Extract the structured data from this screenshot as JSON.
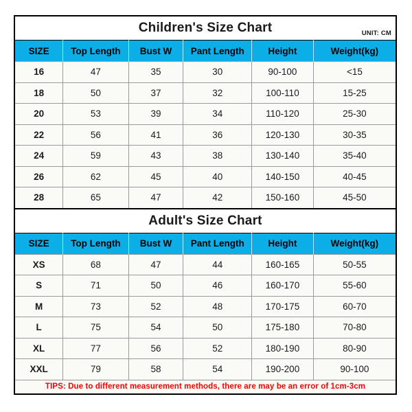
{
  "unit_label": "UNIT: CM",
  "columns": [
    "SIZE",
    "Top Length",
    "Bust W",
    "Pant Length",
    "Height",
    "Weight(kg)"
  ],
  "children": {
    "title": "Children's Size Chart",
    "headers": [
      "SIZE",
      "Top Length",
      "Bust W",
      "Pant Length",
      "Height",
      "Weight(kg)"
    ],
    "rows": [
      [
        "16",
        "47",
        "35",
        "30",
        "90-100",
        "<15"
      ],
      [
        "18",
        "50",
        "37",
        "32",
        "100-110",
        "15-25"
      ],
      [
        "20",
        "53",
        "39",
        "34",
        "110-120",
        "25-30"
      ],
      [
        "22",
        "56",
        "41",
        "36",
        "120-130",
        "30-35"
      ],
      [
        "24",
        "59",
        "43",
        "38",
        "130-140",
        "35-40"
      ],
      [
        "26",
        "62",
        "45",
        "40",
        "140-150",
        "40-45"
      ],
      [
        "28",
        "65",
        "47",
        "42",
        "150-160",
        "45-50"
      ]
    ]
  },
  "adult": {
    "title": "Adult's Size Chart",
    "headers": [
      "SIZE",
      "Top Length",
      "Bust W",
      "Pant Length",
      "Height",
      "Weight(kg)"
    ],
    "rows": [
      [
        "XS",
        "68",
        "47",
        "44",
        "160-165",
        "50-55"
      ],
      [
        "S",
        "71",
        "50",
        "46",
        "160-170",
        "55-60"
      ],
      [
        "M",
        "73",
        "52",
        "48",
        "170-175",
        "60-70"
      ],
      [
        "L",
        "75",
        "54",
        "50",
        "175-180",
        "70-80"
      ],
      [
        "XL",
        "77",
        "56",
        "52",
        "180-190",
        "80-90"
      ],
      [
        "XXL",
        "79",
        "58",
        "54",
        "190-200",
        "90-100"
      ]
    ]
  },
  "tips": "TIPS: Due to different measurement methods, there are may be an error of 1cm-3cm",
  "colors": {
    "header_blue": "#0CAEE8",
    "tips_red": "#FF0000",
    "border_black": "#000000",
    "grid_gray": "#9a9a9a",
    "cell_bg": "#FAFAF7"
  }
}
